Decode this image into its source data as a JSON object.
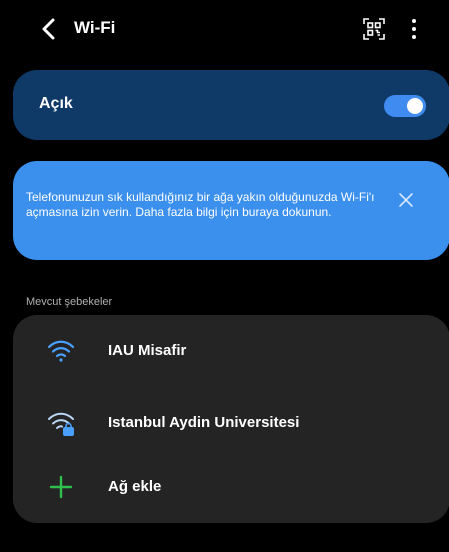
{
  "header": {
    "title": "Wi-Fi",
    "back_icon": "chevron-left-icon",
    "qr_icon": "qr-code-icon",
    "more_icon": "more-vertical-icon"
  },
  "wifi_toggle": {
    "label": "Açık",
    "state": "on",
    "accent": "#3f8bf0"
  },
  "info_banner": {
    "text": "Telefonunuzun sık kullandığınız bir ağa yakın olduğunuzda Wi-Fi'ı açmasına izin verin. Daha fazla bilgi için buraya dokunun.",
    "close_icon": "close-icon",
    "color": "#3b8fed"
  },
  "networks": {
    "section_label": "Mevcut şebekeler",
    "items": [
      {
        "name": "IAU Misafir",
        "icon": "wifi-icon",
        "secured": false
      },
      {
        "name": "Istanbul Aydin Universitesi",
        "icon": "wifi-lock-icon",
        "secured": true
      }
    ],
    "add": {
      "label": "Ağ ekle",
      "icon": "plus-icon",
      "color": "#2fbf4c"
    }
  }
}
